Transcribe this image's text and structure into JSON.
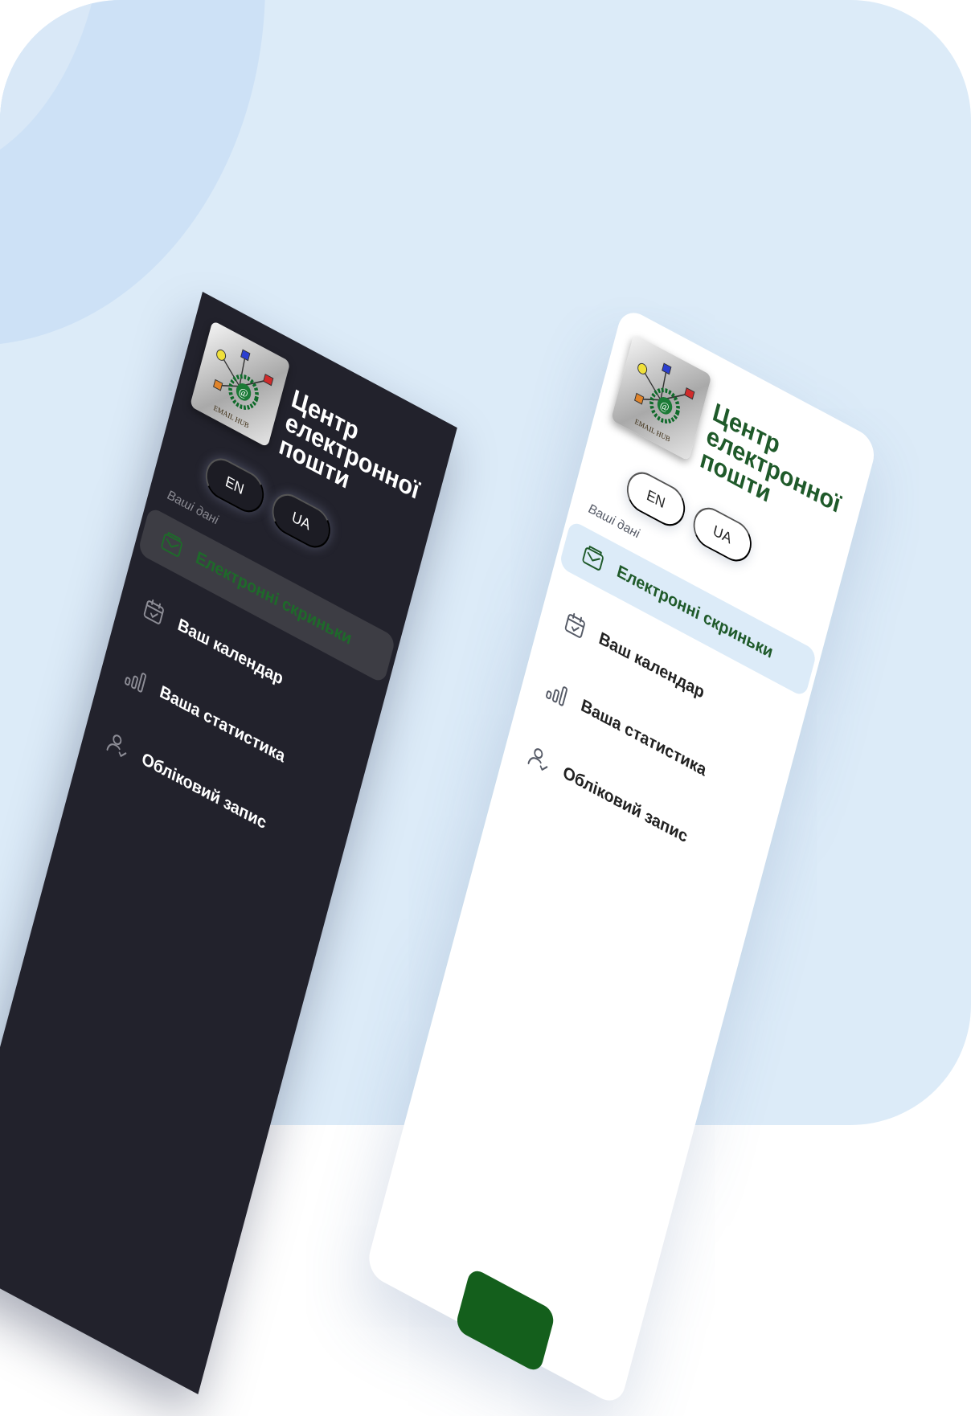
{
  "theme": {
    "backdrop": "#dcebf8",
    "dark_panel": "#22222c",
    "light_panel": "#ffffff",
    "accent_green": "#1f5a2a",
    "active_light_bg": "#dcebf8",
    "active_dark_bg": "#3d3d44",
    "action_green": "#145f1c"
  },
  "brand": {
    "title": "Центр\nелектронної\nпошти",
    "logo_icon": "email-hub-logo"
  },
  "language": {
    "en": "EN",
    "ua": "UA"
  },
  "sidebar": {
    "section_label": "Ваші дані",
    "items": [
      {
        "label": "Електронні скриньки",
        "icon": "mailbox-icon",
        "active": true
      },
      {
        "label": "Ваш календар",
        "icon": "calendar-check-icon",
        "active": false
      },
      {
        "label": "Ваша статистика",
        "icon": "bar-chart-icon",
        "active": false
      },
      {
        "label": "Обліковий запис",
        "icon": "user-check-icon",
        "active": false
      }
    ]
  }
}
